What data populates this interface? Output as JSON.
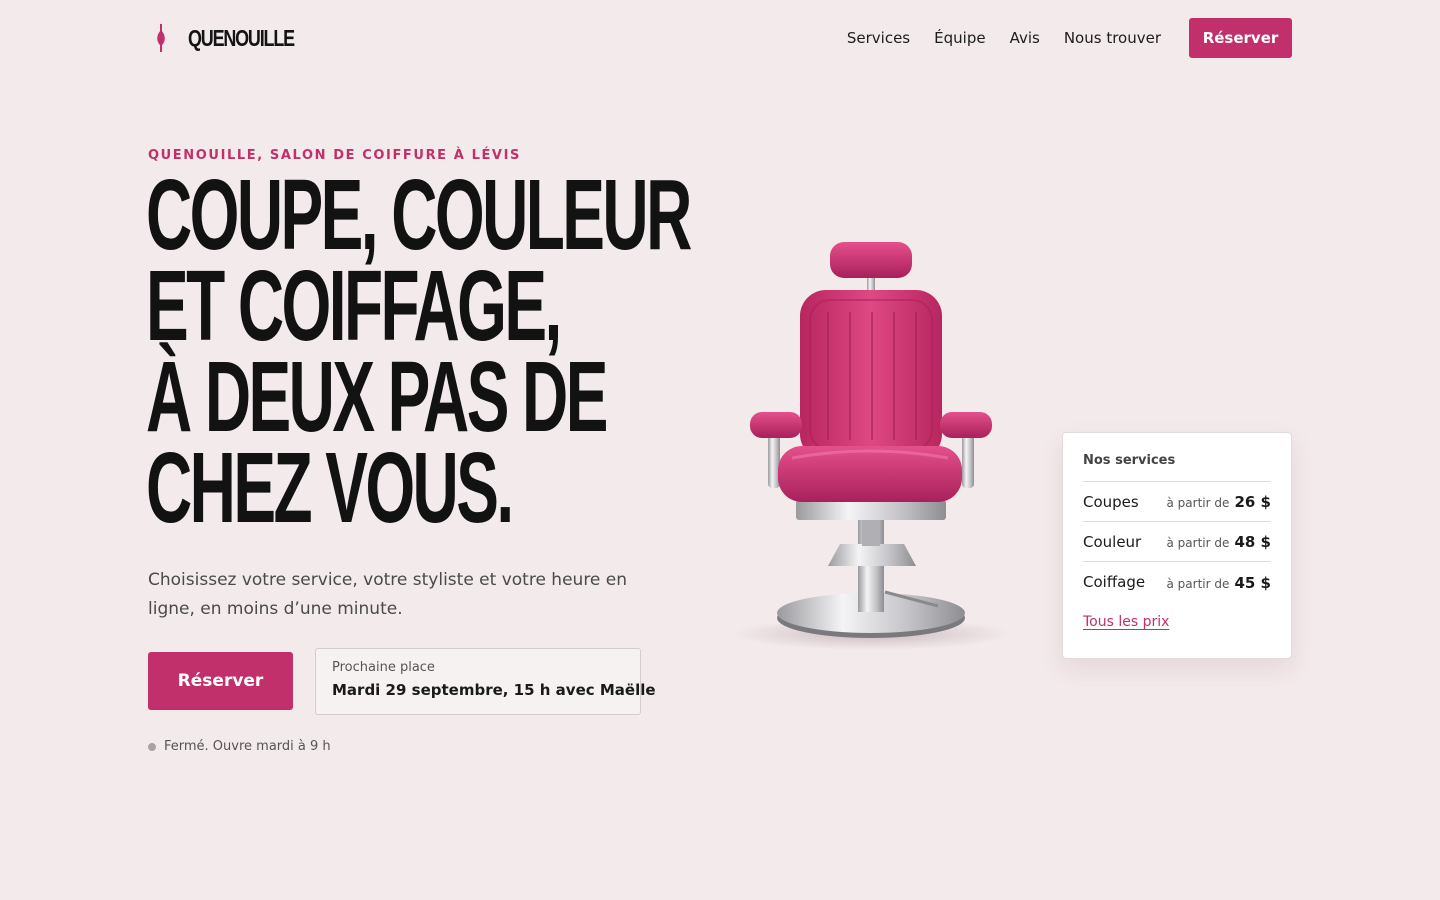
{
  "brand": {
    "name": "QUENOUILLE",
    "accent": "#c1306b",
    "background": "#f3eaeb"
  },
  "nav": {
    "items": [
      "Services",
      "Équipe",
      "Avis",
      "Nous trouver"
    ],
    "cta_label": "Réserver"
  },
  "hero": {
    "eyebrow": "QUENOUILLE, SALON DE COIFFURE À LÉVIS",
    "headline_lines": [
      "COUPE, COULEUR",
      "ET COIFFAGE,",
      "À DEUX PAS DE",
      "CHEZ VOUS."
    ],
    "subtitle": "Choisissez votre service, votre styliste et votre heure en ligne, en moins d’une minute.",
    "cta_label": "Réserver",
    "next_slot_label": "Prochaine place",
    "next_slot_value": "Mardi 29 septembre, 15 h avec Maëlle",
    "status_text": "Fermé. Ouvre mardi à 9 h",
    "status_color": "#a9a3a4"
  },
  "services_card": {
    "title": "Nos services",
    "items": [
      {
        "name": "Coupes",
        "from": "à partir de",
        "price": "26 $"
      },
      {
        "name": "Couleur",
        "from": "à partir de",
        "price": "48 $"
      },
      {
        "name": "Coiffage",
        "from": "à partir de",
        "price": "45 $"
      }
    ],
    "link_label": "Tous les prix"
  },
  "icons": {
    "logo": "spindle-icon",
    "hero_image": "salon-chair-icon"
  }
}
